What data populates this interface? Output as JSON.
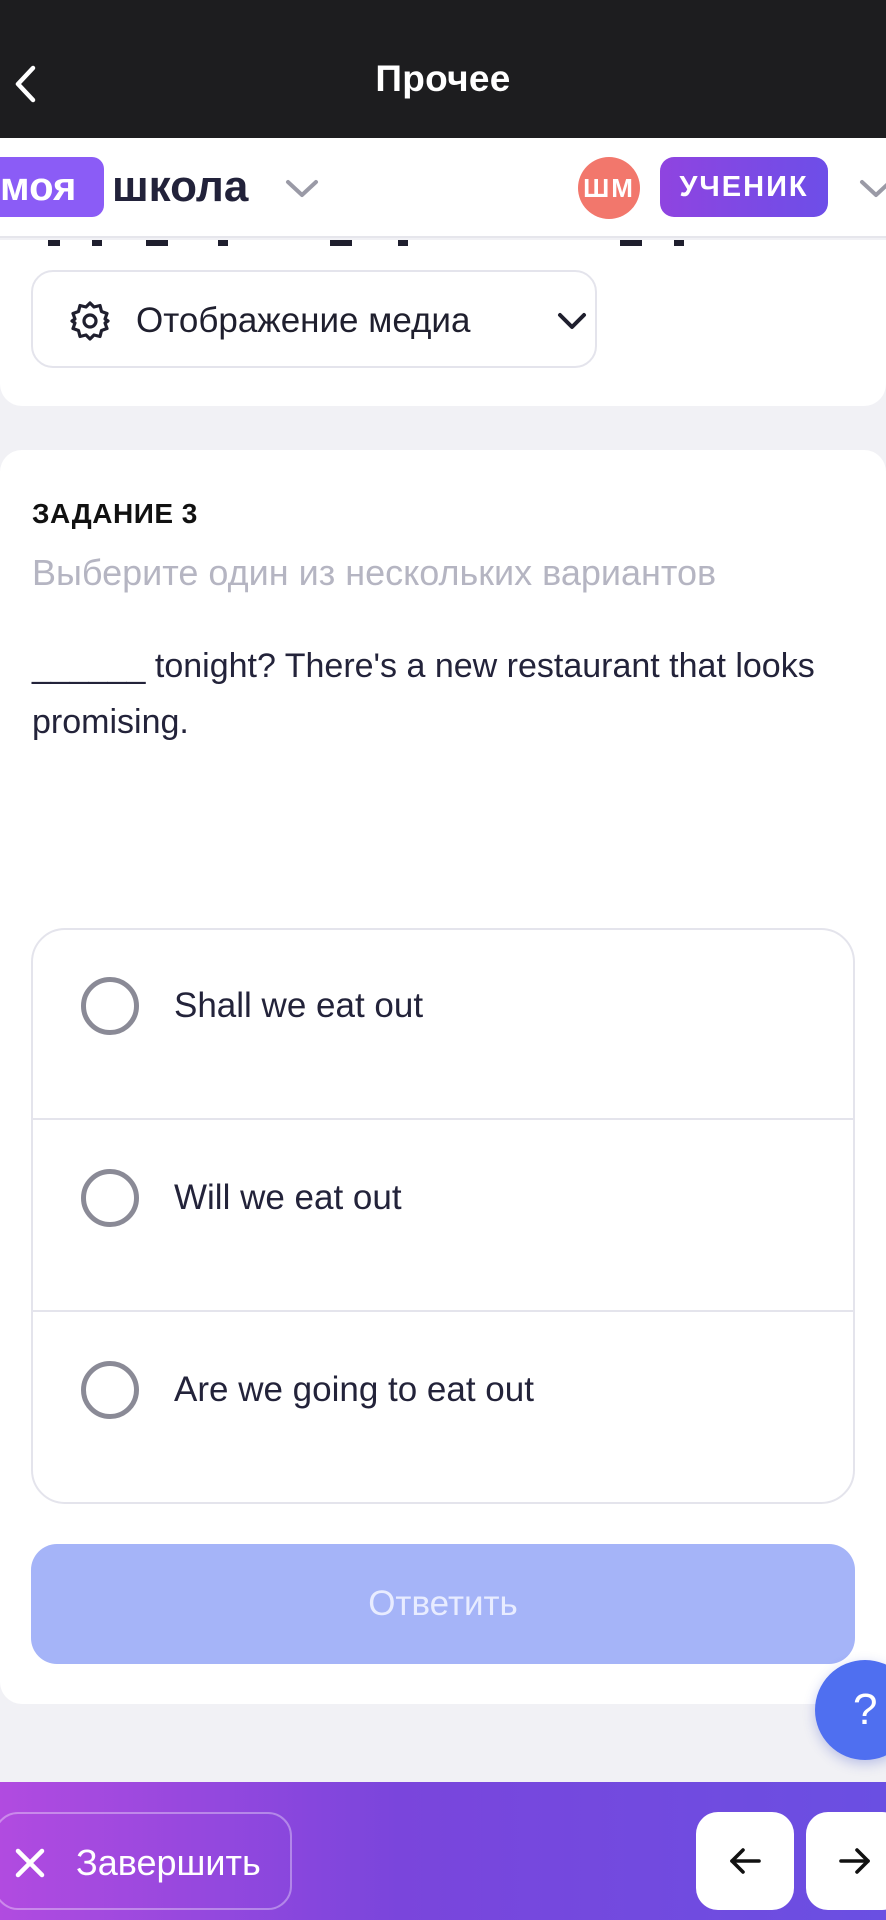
{
  "topbar": {
    "title": "Прочее"
  },
  "header": {
    "logo_part1": "моя",
    "logo_part2": "школа",
    "avatar_initials": "ШМ",
    "role": "УЧЕНИК"
  },
  "media": {
    "label": "Отображение медиа"
  },
  "task": {
    "number": "ЗАДАНИЕ 3",
    "hint": "Выберите один из нескольких вариантов",
    "question": "______ tonight? There's a new restaurant that looks promising.",
    "options": [
      {
        "label": "Shall we eat out"
      },
      {
        "label": "Will we eat out"
      },
      {
        "label": "Are we going to eat out"
      }
    ],
    "submit_label": "Ответить"
  },
  "help": {
    "label": "?"
  },
  "bottombar": {
    "finish_label": "Завершить"
  },
  "colors": {
    "accent": "#8b5cf6",
    "avatar": "#f2776c",
    "submit_disabled": "#a5b4f8",
    "help": "#4f6ff0"
  },
  "icons": [
    "back-chevron-icon",
    "chevron-down-icon",
    "gear-icon",
    "radio-icon",
    "close-icon",
    "arrow-left-icon",
    "arrow-right-icon"
  ]
}
